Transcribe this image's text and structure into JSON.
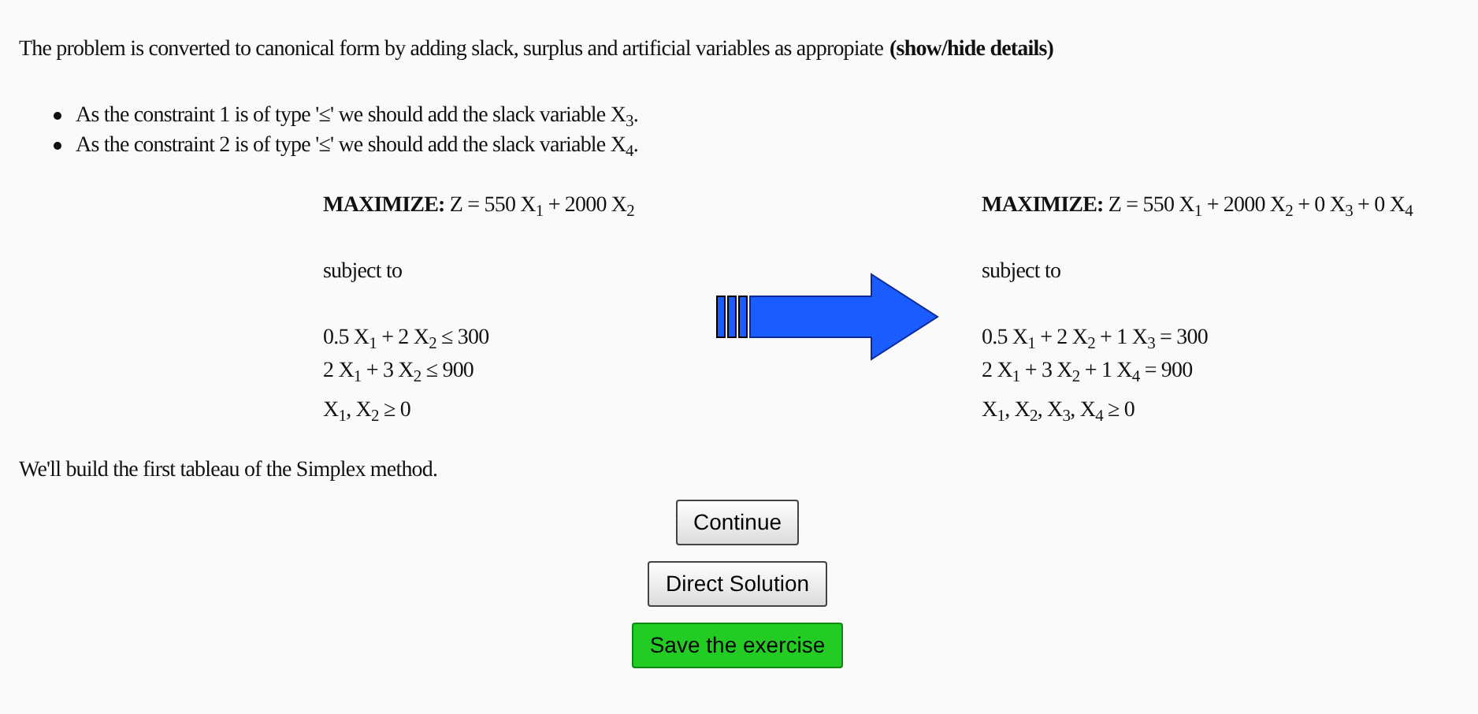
{
  "intro": {
    "text": "The problem is converted to canonical form by adding slack, surplus and artificial variables as appropiate",
    "link": "(show/hide details)"
  },
  "details": [
    {
      "text": "As the constraint 1 is of type '≤' we should add the slack variable X$_{3}$."
    },
    {
      "text": "As the constraint 2 is of type '≤' we should add the slack variable X$_{4}$."
    }
  ],
  "original_model": {
    "objective": "**MAXIMIZE:** Z = 550 X$_{1}$ + 2000 X$_{2}$",
    "subject_to": "subject to",
    "constraints": [
      "0.5 X$_{1}$ + 2 X$_{2}$ ≤ 300",
      "2 X$_{1}$ + 3 X$_{2}$ ≤ 900"
    ],
    "nonnegativity": "X$_{1}$, X$_{2}$ ≥ 0"
  },
  "canonical_model": {
    "objective": "**MAXIMIZE:** Z = 550 X$_{1}$ + 2000 X$_{2}$ + 0 X$_{3}$ + 0 X$_{4}$",
    "subject_to": "subject to",
    "constraints": [
      "0.5 X$_{1}$ + 2 X$_{2}$ + 1 X$_{3}$ = 300",
      "2 X$_{1}$ + 3 X$_{2}$ + 1 X$_{4}$ = 900"
    ],
    "nonnegativity": "X$_{1}$, X$_{2}$, X$_{3}$, X$_{4}$ ≥ 0"
  },
  "next_step": "We'll build the first tableau of the Simplex method.",
  "buttons": [
    {
      "label": "Continue",
      "kind": "default"
    },
    {
      "label": "Direct Solution",
      "kind": "default"
    },
    {
      "label": "Save the exercise",
      "kind": "save"
    }
  ]
}
